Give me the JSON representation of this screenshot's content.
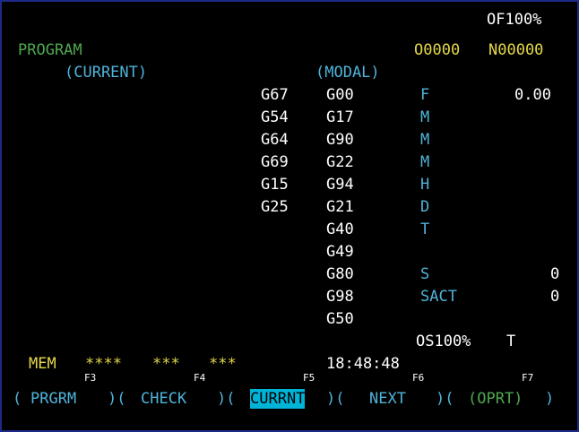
{
  "override": "OF100%",
  "program": {
    "title": "PROGRAM",
    "o_number": "O0000",
    "n_number": "N00000"
  },
  "section": {
    "current": "(CURRENT)",
    "modal": "(MODAL)"
  },
  "current_codes": [
    "G67",
    "G54",
    "G64",
    "G69",
    "G15",
    "G25"
  ],
  "modal_codes": [
    "G00",
    "G17",
    "G90",
    "G22",
    "G94",
    "G21",
    "G40",
    "G49",
    "G80",
    "G98",
    "G50"
  ],
  "aux": [
    {
      "label": "F",
      "value": "0.00"
    },
    {
      "label": "M",
      "value": ""
    },
    {
      "label": "M",
      "value": ""
    },
    {
      "label": "M",
      "value": ""
    },
    {
      "label": "H",
      "value": ""
    },
    {
      "label": "D",
      "value": ""
    },
    {
      "label": "T",
      "value": ""
    }
  ],
  "spindle": [
    {
      "label": "S",
      "value": "0"
    },
    {
      "label": "SACT",
      "value": "0"
    }
  ],
  "spindle_override": "OS100%",
  "tool_label": "T",
  "status": {
    "mode": "MEM",
    "s1": "****",
    "s2": "***",
    "s3": "***",
    "time": "18:48:48"
  },
  "fkeys": [
    "F3",
    "F4",
    "F5",
    "F6",
    "F7"
  ],
  "softkeys": [
    "PRGRM",
    "CHECK",
    "CURRNT",
    "NEXT",
    "(OPRT)"
  ],
  "colors": {
    "border": "#1e2a8a",
    "active": "#00b4d8",
    "label_green": "#4fa84f",
    "cyan": "#4fb3d9",
    "yellow": "#e6d84a"
  }
}
